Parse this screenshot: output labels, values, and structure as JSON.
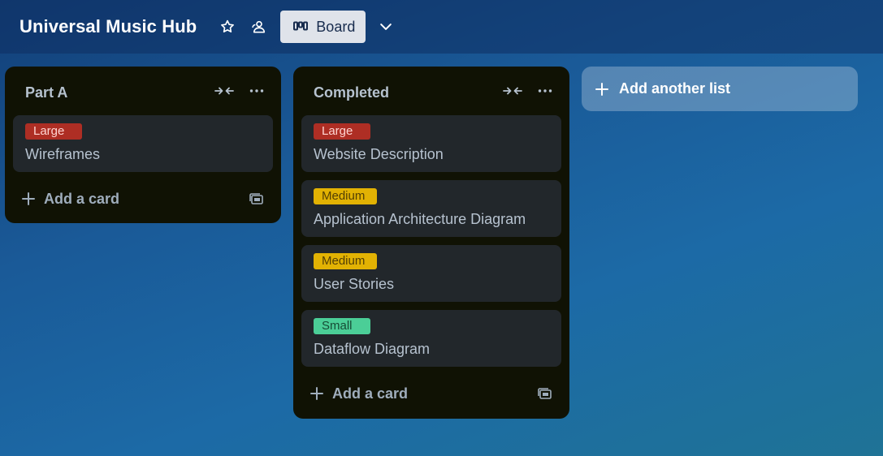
{
  "board": {
    "title": "Universal Music Hub",
    "view_label": "Board",
    "icons": {
      "star": "star-icon",
      "visibility": "workspace-visible-icon",
      "view": "board-view-icon",
      "menu": "chevron-down-icon"
    }
  },
  "lists": [
    {
      "title": "Part A",
      "cards": [
        {
          "label": "Large",
          "label_color": "#ae2e24",
          "title": "Wireframes"
        }
      ],
      "add_card_label": "Add a card"
    },
    {
      "title": "Completed",
      "cards": [
        {
          "label": "Large",
          "label_color": "#ae2e24",
          "title": "Website Description"
        },
        {
          "label": "Medium",
          "label_color": "#e2b203",
          "title": "Application Architecture Diagram"
        },
        {
          "label": "Medium",
          "label_color": "#e2b203",
          "title": "User Stories"
        },
        {
          "label": "Small",
          "label_color": "#4bce97",
          "title": "Dataflow Diagram"
        }
      ],
      "add_card_label": "Add a card"
    }
  ],
  "add_list_label": "Add another list",
  "colors": {
    "list_bg": "#101204",
    "card_bg": "#22272b",
    "text": "#b6c2cf",
    "label_large": "#ae2e24",
    "label_medium": "#e2b203",
    "label_small": "#4bce97"
  }
}
